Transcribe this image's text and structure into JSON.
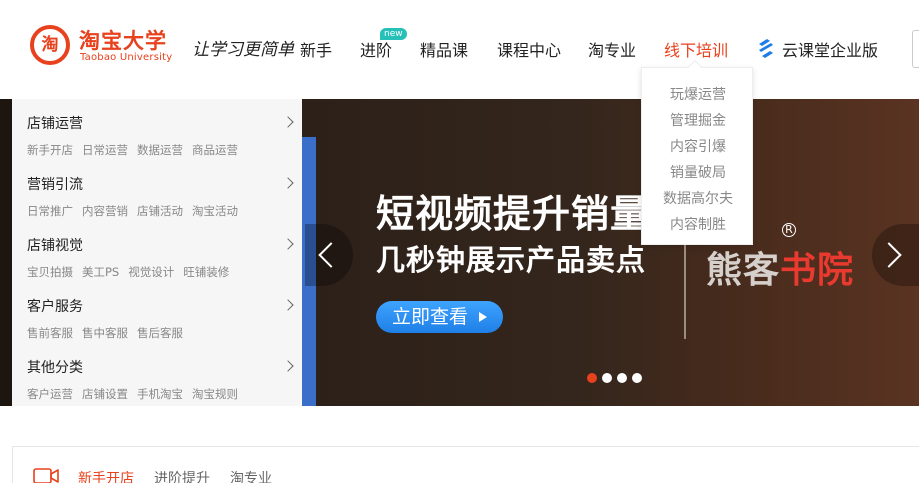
{
  "brand": {
    "logo_char": "淘",
    "name_cn": "淘宝大学",
    "name_en": "Taobao University",
    "slogan": "让学习更简单",
    "color": "#e8411d"
  },
  "nav": {
    "items": [
      {
        "label": "新手"
      },
      {
        "label": "进阶",
        "badge": "new"
      },
      {
        "label": "精品课"
      },
      {
        "label": "课程中心"
      },
      {
        "label": "淘专业"
      },
      {
        "label": "线下培训",
        "active": true
      },
      {
        "label": "云课堂企业版",
        "icon": "cloud-classroom-icon"
      }
    ],
    "active_color": "#e8411d"
  },
  "dropdown": {
    "items": [
      "玩爆运营",
      "管理掘金",
      "内容引爆",
      "销量破局",
      "数据高尔夫",
      "内容制胜"
    ]
  },
  "categories": [
    {
      "title": "店铺运营",
      "subs": [
        "新手开店",
        "日常运营",
        "数据运营",
        "商品运营"
      ]
    },
    {
      "title": "营销引流",
      "subs": [
        "日常推广",
        "内容营销",
        "店铺活动",
        "淘宝活动"
      ]
    },
    {
      "title": "店铺视觉",
      "subs": [
        "宝贝拍摄",
        "美工PS",
        "视觉设计",
        "旺铺装修"
      ]
    },
    {
      "title": "客户服务",
      "subs": [
        "售前客服",
        "售中客服",
        "售后客服"
      ]
    },
    {
      "title": "其他分类",
      "subs": [
        "客户运营",
        "店铺设置",
        "手机淘宝",
        "淘宝规则"
      ]
    }
  ],
  "banner": {
    "title": "短视频提升销量利器",
    "subtitle": "几秒钟展示产品卖点",
    "button_label": "立即查看",
    "brand_part1": "熊客",
    "brand_part2": "书院",
    "brand_reg": "R",
    "slide_count": 4,
    "active_slide": 0
  },
  "bottom_tabs": {
    "items": [
      {
        "label": "新手开店",
        "active": true
      },
      {
        "label": "进阶提升"
      },
      {
        "label": "淘专业"
      }
    ]
  }
}
